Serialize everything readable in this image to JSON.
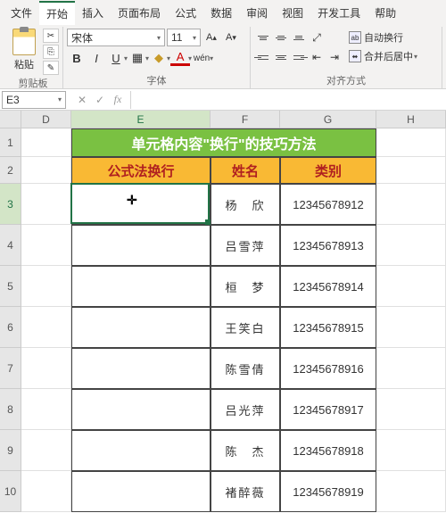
{
  "menu": {
    "items": [
      "文件",
      "开始",
      "插入",
      "页面布局",
      "公式",
      "数据",
      "审阅",
      "视图",
      "开发工具",
      "帮助"
    ],
    "active_index": 1
  },
  "ribbon": {
    "clipboard": {
      "paste": "粘贴",
      "label": "剪贴板"
    },
    "font": {
      "name": "宋体",
      "size": "11",
      "label": "字体",
      "bold": "B",
      "italic": "I",
      "underline": "U"
    },
    "alignment": {
      "wrap": "自动换行",
      "merge": "合并后居中",
      "label": "对齐方式"
    }
  },
  "namebox": "E3",
  "columns": [
    "D",
    "E",
    "F",
    "G",
    "H"
  ],
  "active_col": "E",
  "active_row": "3",
  "table": {
    "title": "单元格内容\"换行\"的技巧方法",
    "headers": {
      "e": "公式法换行",
      "f": "姓名",
      "g": "类别"
    },
    "rows": [
      {
        "e": "",
        "f": "杨　欣",
        "g": "12345678912"
      },
      {
        "e": "",
        "f": "吕雪萍",
        "g": "12345678913"
      },
      {
        "e": "",
        "f": "桓　梦",
        "g": "12345678914"
      },
      {
        "e": "",
        "f": "王笑白",
        "g": "12345678915"
      },
      {
        "e": "",
        "f": "陈雪倩",
        "g": "12345678916"
      },
      {
        "e": "",
        "f": "吕光萍",
        "g": "12345678917"
      },
      {
        "e": "",
        "f": "陈　杰",
        "g": "12345678918"
      },
      {
        "e": "",
        "f": "褚醉薇",
        "g": "12345678919"
      }
    ]
  }
}
